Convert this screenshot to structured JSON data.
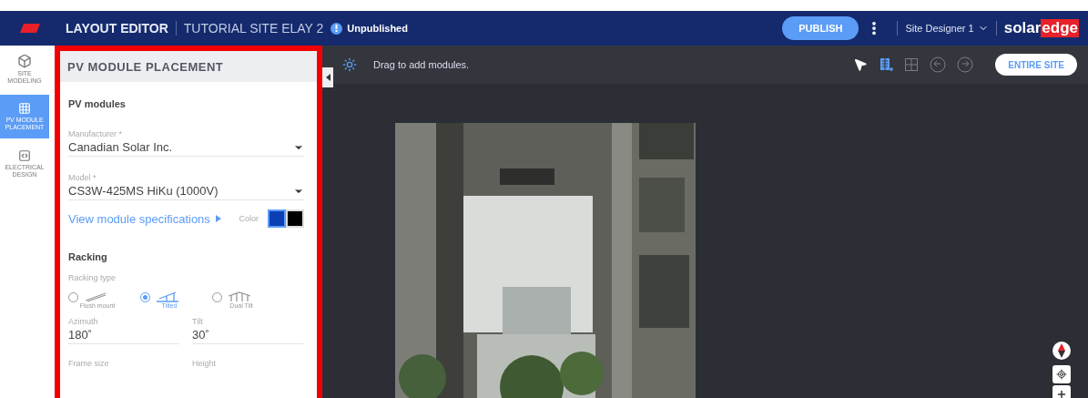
{
  "header": {
    "title": "LAYOUT EDITOR",
    "site": "TUTORIAL SITE ELAY 2",
    "status": "Unpublished",
    "publish": "PUBLISH",
    "user": "Site Designer 1",
    "brand": {
      "first": "solar",
      "second": "edge"
    }
  },
  "rail": [
    {
      "kind": "cube",
      "label": "SITE MODELING",
      "selected": false
    },
    {
      "kind": "grid",
      "label": "PV MODULE PLACEMENT",
      "selected": true
    },
    {
      "kind": "plug",
      "label": "ELECTRICAL DESIGN",
      "selected": false
    }
  ],
  "panel": {
    "title": "PV MODULE PLACEMENT",
    "modules_heading": "PV modules",
    "manufacturer": {
      "label": "Manufacturer *",
      "value": "Canadian Solar Inc."
    },
    "model": {
      "label": "Model *",
      "value": "CS3W-425MS HiKu (1000V)"
    },
    "spec_link": "View module specifications",
    "color_label": "Color",
    "colors": [
      {
        "color": "#0b3fb3",
        "selected": true
      },
      {
        "color": "#000000",
        "selected": false
      }
    ],
    "racking_heading": "Racking",
    "racking_type_label": "Racking type",
    "racking_options": [
      {
        "kind": "flush",
        "label": "Flush mount",
        "selected": false
      },
      {
        "kind": "tilted",
        "label": "Tilted",
        "selected": true
      },
      {
        "kind": "dual",
        "label": "Dual Tilt",
        "selected": false
      }
    ],
    "fields": [
      {
        "label": "Azimuth",
        "value": "180˚"
      },
      {
        "label": "Tilt",
        "value": "30˚"
      }
    ],
    "next_labels": [
      "Frame size",
      "Height"
    ]
  },
  "toolbar": {
    "hint": "Drag to add modules.",
    "tools": [
      {
        "kind": "pointer",
        "selected": false,
        "disabled": false
      },
      {
        "kind": "add-modules",
        "selected": true,
        "disabled": false
      },
      {
        "kind": "grid",
        "selected": false,
        "disabled": true
      },
      {
        "kind": "undo",
        "selected": false,
        "disabled": true
      },
      {
        "kind": "redo",
        "selected": false,
        "disabled": true
      }
    ],
    "scope": "ENTIRE SITE"
  }
}
